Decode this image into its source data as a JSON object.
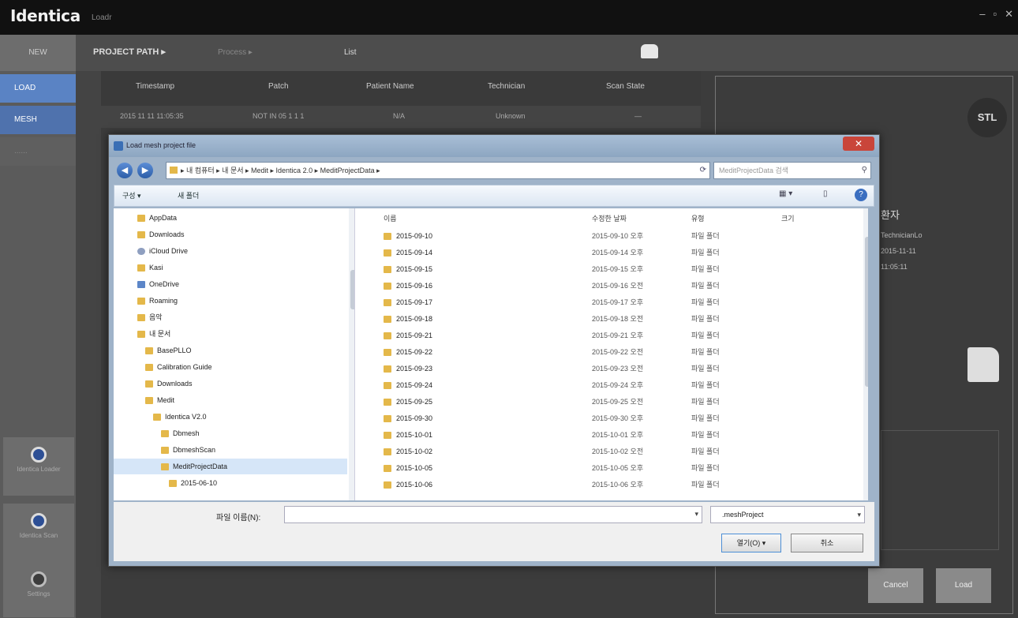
{
  "app": {
    "logo": "Identica",
    "subtitle": "Loadr",
    "win_min": "–",
    "win_max": "▫",
    "win_close": "✕"
  },
  "sidebar": {
    "new_label": "NEW",
    "load_label": "LOAD",
    "mesh_label": "MESH",
    "empty_label": "......",
    "btn1_label": "Identica Loader",
    "btn2_label": "Identica Scan",
    "btn3_label": "Settings"
  },
  "menubar": {
    "crumb": "PROJECT PATH ▸",
    "m2": "Process ▸",
    "m3": "List"
  },
  "list": {
    "columns": [
      "Timestamp",
      "Patch",
      "Patient Name",
      "Technician",
      "Scan State"
    ],
    "row": [
      "2015 11 11 11:05:35",
      "NOT IN 05 1 1 1",
      "N/A",
      "Unknown",
      "—"
    ]
  },
  "preview": {
    "badge": "STL",
    "name_label": "환자",
    "info1": "TechnicianLo",
    "info2": "2015-11-11",
    "info3": "11:05:11",
    "cancel_label": "Cancel",
    "load_label": "Load"
  },
  "dialog": {
    "title": "Load mesh project file",
    "close": "✕",
    "back": "◀",
    "forward": "▶",
    "address": "▸ 내 컴퓨터 ▸ 내 문서 ▸ Medit ▸ Identica 2.0 ▸ MeditProjectData ▸",
    "refresh": "⟳",
    "search_placeholder": "MeditProjectData 검색",
    "toolbar_organize": "구성 ▾",
    "toolbar_newfolder": "새 폴더",
    "view_icon": "▦ ▾",
    "pane_icon": "▯",
    "help_icon": "?",
    "tree": [
      {
        "label": "AppData",
        "level": 0,
        "icon": "folder"
      },
      {
        "label": "Downloads",
        "level": 0,
        "icon": "folder"
      },
      {
        "label": "iCloud Drive",
        "level": 0,
        "icon": "cloud"
      },
      {
        "label": "Kasi",
        "level": 0,
        "icon": "folder"
      },
      {
        "label": "OneDrive",
        "level": 0,
        "icon": "blue"
      },
      {
        "label": "Roaming",
        "level": 0,
        "icon": "folder"
      },
      {
        "label": "음악",
        "level": 0,
        "icon": "folder"
      },
      {
        "label": "내 문서",
        "level": 0,
        "icon": "folder"
      },
      {
        "label": "BasePLLO",
        "level": 1,
        "icon": "folder"
      },
      {
        "label": "Calibration Guide",
        "level": 1,
        "icon": "folder"
      },
      {
        "label": "Downloads",
        "level": 1,
        "icon": "folder"
      },
      {
        "label": "Medit",
        "level": 1,
        "icon": "folder"
      },
      {
        "label": "Identica V2.0",
        "level": 2,
        "icon": "folder"
      },
      {
        "label": "Dbmesh",
        "level": 3,
        "icon": "folder"
      },
      {
        "label": "DbmeshScan",
        "level": 3,
        "icon": "folder"
      },
      {
        "label": "MeditProjectData",
        "level": 3,
        "icon": "folder",
        "selected": true
      },
      {
        "label": "2015-06-10",
        "level": 4,
        "icon": "folder"
      }
    ],
    "columns": {
      "name": "이름",
      "date": "수정한 날짜",
      "type": "유형",
      "size": "크기"
    },
    "files": [
      {
        "name": "2015-09-10",
        "date": "2015-09-10 오후",
        "type": "파일 폴더"
      },
      {
        "name": "2015-09-14",
        "date": "2015-09-14 오후",
        "type": "파일 폴더"
      },
      {
        "name": "2015-09-15",
        "date": "2015-09-15 오후",
        "type": "파일 폴더"
      },
      {
        "name": "2015-09-16",
        "date": "2015-09-16 오전",
        "type": "파일 폴더"
      },
      {
        "name": "2015-09-17",
        "date": "2015-09-17 오후",
        "type": "파일 폴더"
      },
      {
        "name": "2015-09-18",
        "date": "2015-09-18 오전",
        "type": "파일 폴더"
      },
      {
        "name": "2015-09-21",
        "date": "2015-09-21 오후",
        "type": "파일 폴더"
      },
      {
        "name": "2015-09-22",
        "date": "2015-09-22 오전",
        "type": "파일 폴더"
      },
      {
        "name": "2015-09-23",
        "date": "2015-09-23 오전",
        "type": "파일 폴더"
      },
      {
        "name": "2015-09-24",
        "date": "2015-09-24 오후",
        "type": "파일 폴더"
      },
      {
        "name": "2015-09-25",
        "date": "2015-09-25 오전",
        "type": "파일 폴더"
      },
      {
        "name": "2015-09-30",
        "date": "2015-09-30 오후",
        "type": "파일 폴더"
      },
      {
        "name": "2015-10-01",
        "date": "2015-10-01 오후",
        "type": "파일 폴더"
      },
      {
        "name": "2015-10-02",
        "date": "2015-10-02 오전",
        "type": "파일 폴더"
      },
      {
        "name": "2015-10-05",
        "date": "2015-10-05 오후",
        "type": "파일 폴더"
      },
      {
        "name": "2015-10-06",
        "date": "2015-10-06 오후",
        "type": "파일 폴더"
      }
    ],
    "filename_label": "파일 이름(N):",
    "filename_value": "",
    "dropdown_arrow": "▾",
    "filter_value": ".meshProject",
    "open_label": "열기(O)  ▾",
    "cancel_label": "취소"
  }
}
